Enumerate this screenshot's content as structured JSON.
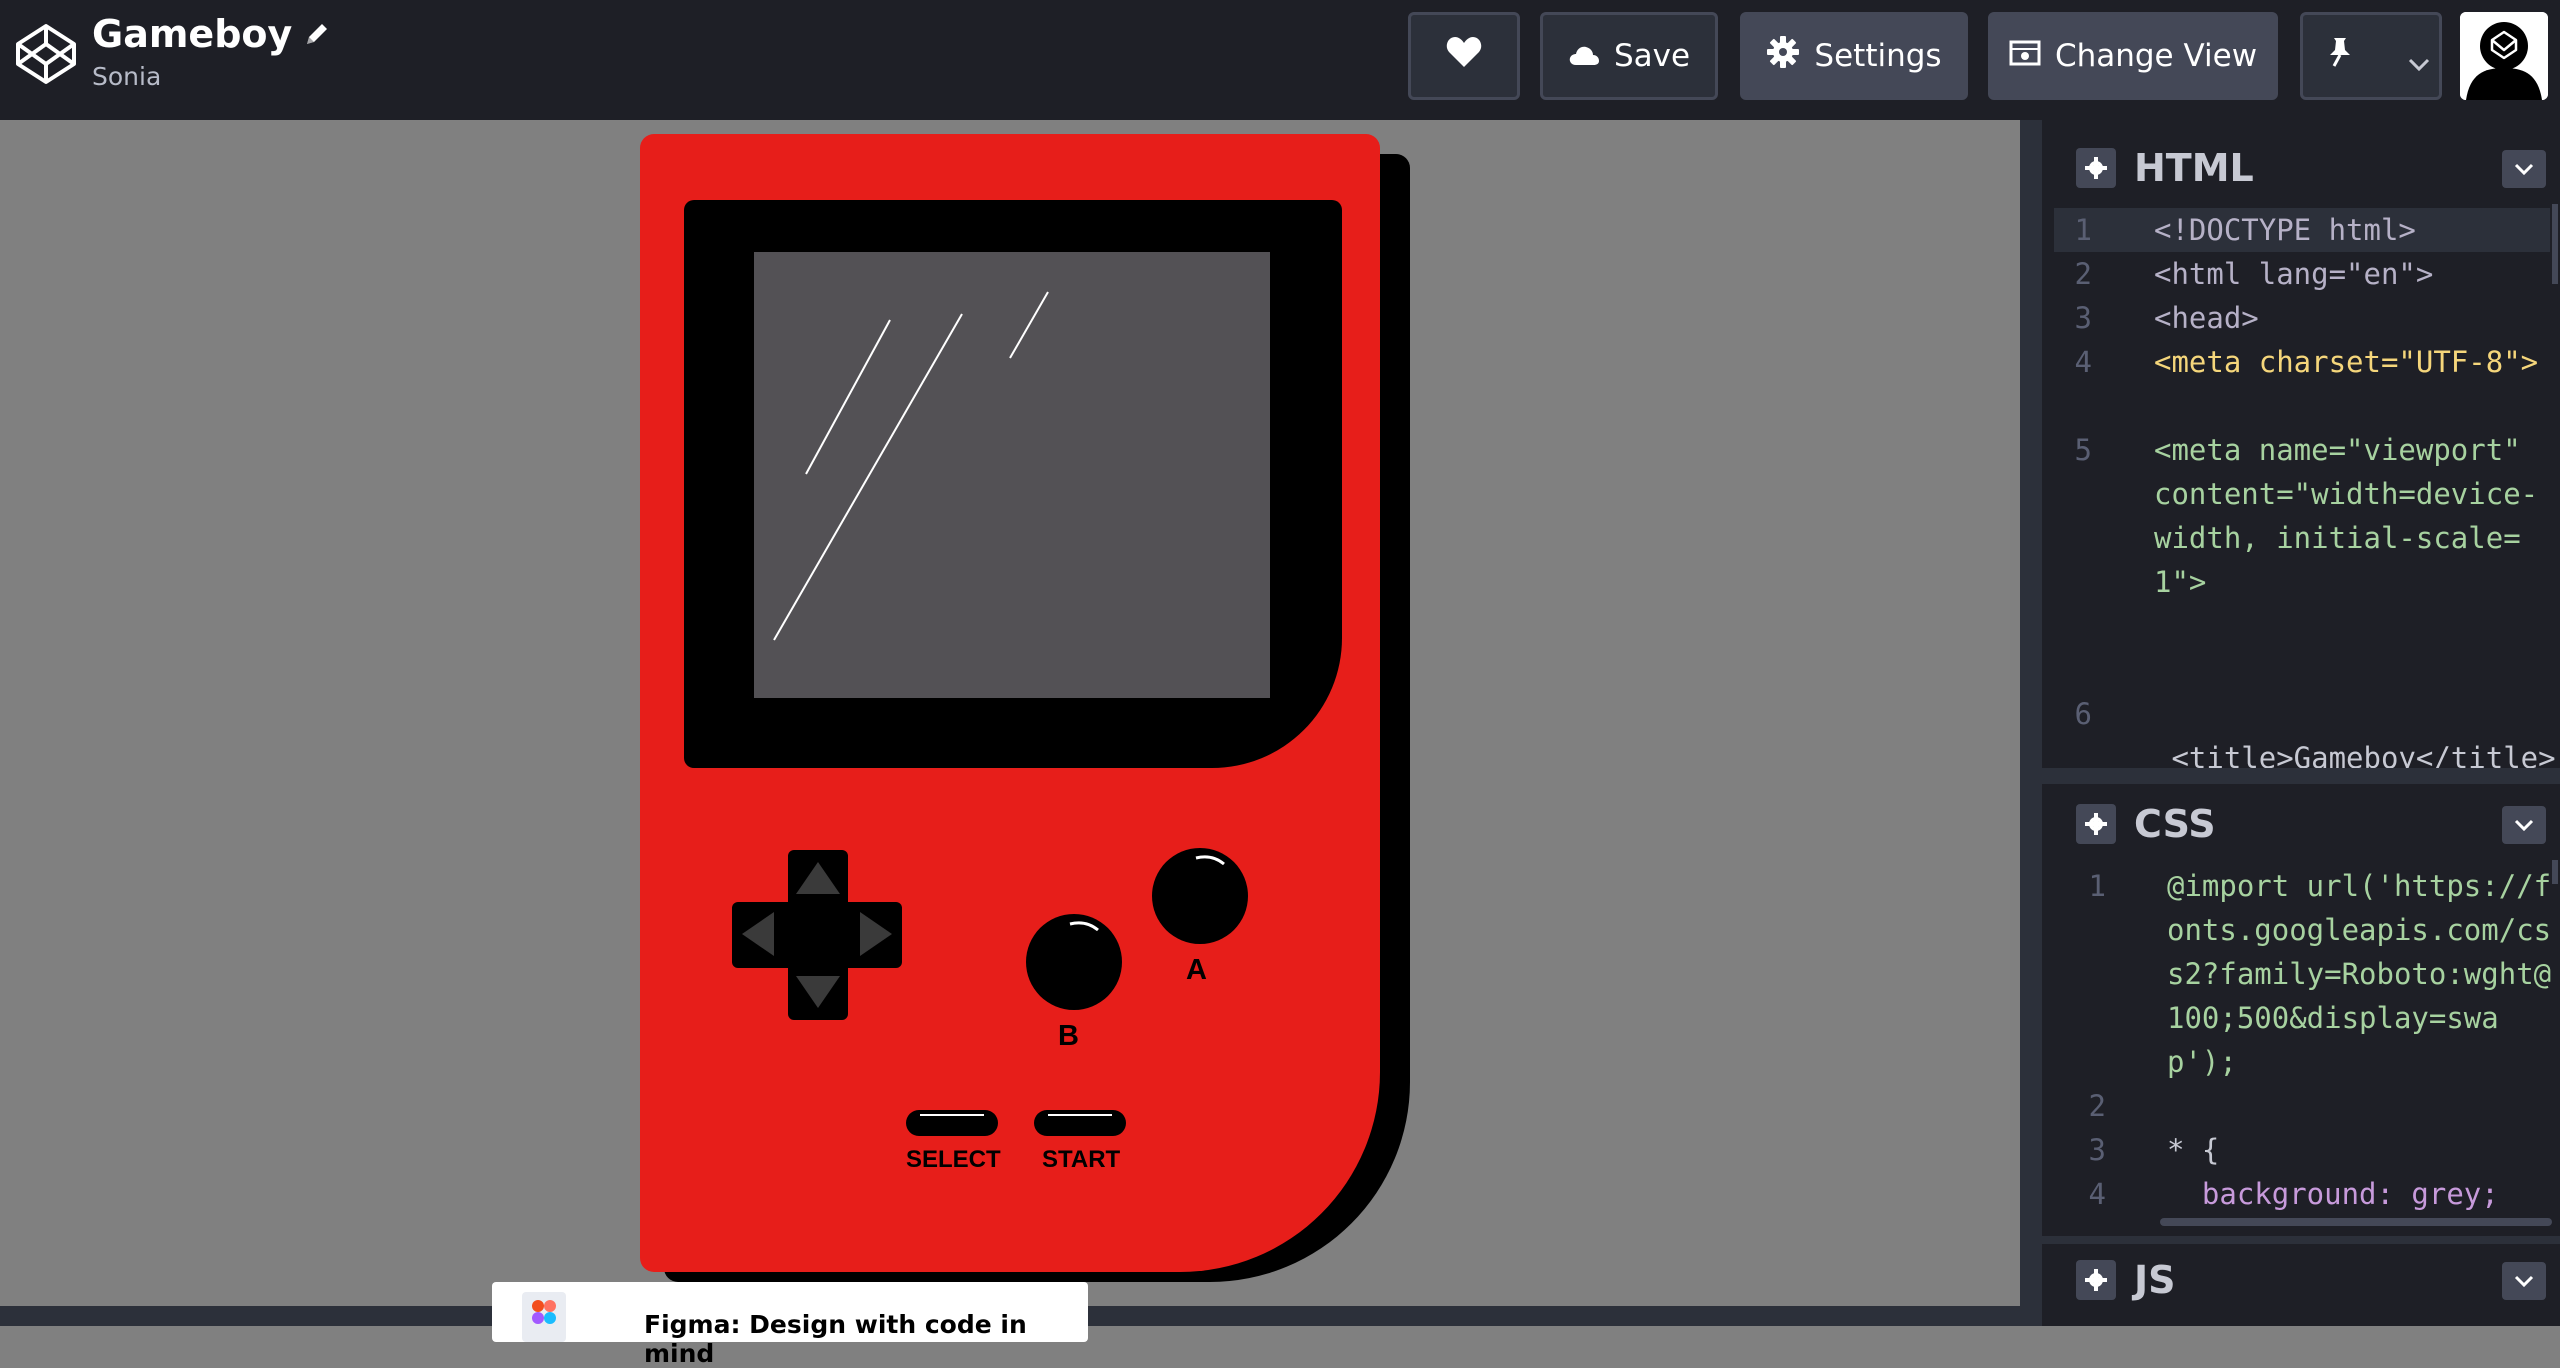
{
  "header": {
    "title": "Gameboy",
    "author": "Sonia",
    "buttons": {
      "save": "Save",
      "settings": "Settings",
      "change_view": "Change View"
    }
  },
  "gameboy": {
    "button_a": "A",
    "button_b": "B",
    "select": "SELECT",
    "start": "START"
  },
  "toast": {
    "text": "Figma: Design with code in mind"
  },
  "editor": {
    "html_panel": {
      "title": "HTML",
      "lines": [
        {
          "n": "1",
          "text": "<!DOCTYPE html>"
        },
        {
          "n": "2",
          "text": "<html lang=\"en\">"
        },
        {
          "n": "3",
          "text": "<head>"
        },
        {
          "n": "4",
          "text": "  <meta charset=\"UTF-8\">"
        },
        {
          "n": "5",
          "text": "  <meta name=\"viewport\" content=\"width=device-width, initial-scale=1\">"
        },
        {
          "n": "6",
          "text": " <title>Gameboy</title>"
        }
      ]
    },
    "css_panel": {
      "title": "CSS",
      "lines": [
        {
          "n": "1",
          "text": "@import url('https://fonts.googleapis.com/css2?family=Roboto:wght@100;500&display=swap');"
        },
        {
          "n": "2",
          "text": ""
        },
        {
          "n": "3",
          "text": "* {"
        },
        {
          "n": "4",
          "text": "  background: grey;"
        }
      ]
    },
    "js_panel": {
      "title": "JS"
    }
  },
  "colors": {
    "gameboy_body": "#e71e1a",
    "screen": "#535155",
    "preview_bg": "#808080",
    "topbar_bg": "#1e1f26"
  }
}
